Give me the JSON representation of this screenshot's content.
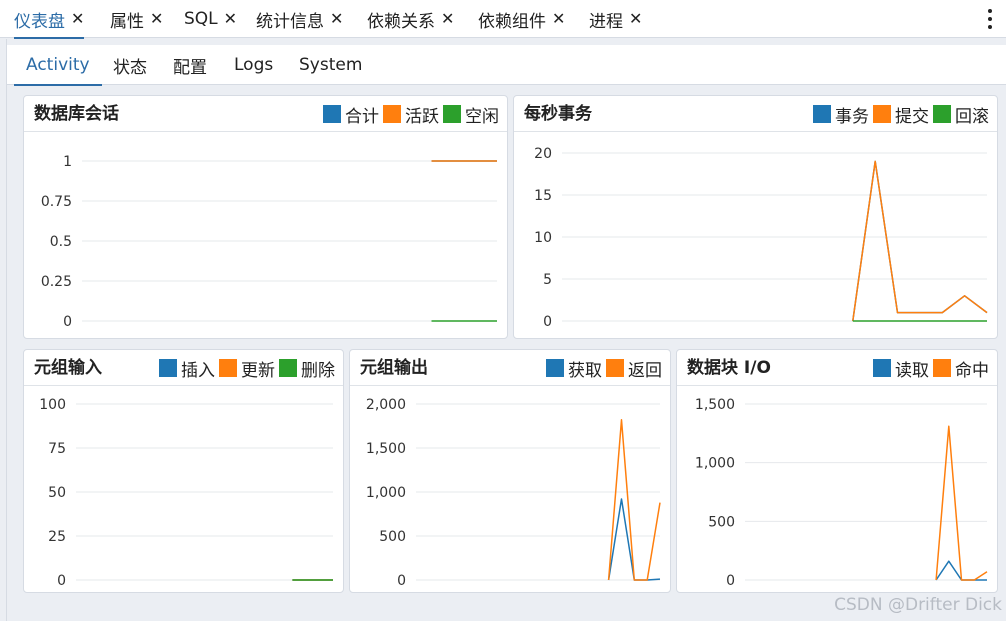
{
  "top_tabs": [
    {
      "label": "仪表盘",
      "active": true
    },
    {
      "label": "属性"
    },
    {
      "label": "SQL"
    },
    {
      "label": "统计信息"
    },
    {
      "label": "依赖关系"
    },
    {
      "label": "依赖组件"
    },
    {
      "label": "进程"
    }
  ],
  "sub_tabs": [
    {
      "label": "Activity",
      "active": true
    },
    {
      "label": "状态"
    },
    {
      "label": "配置"
    },
    {
      "label": "Logs"
    },
    {
      "label": "System"
    }
  ],
  "colors": {
    "blue": "#1f77b4",
    "orange": "#ff7f0e",
    "green": "#2ca02c",
    "accent": "#2c6ca7"
  },
  "watermark": "CSDN @Drifter Dick",
  "chart_data": [
    {
      "id": "sessions",
      "type": "line",
      "title": "数据库会话",
      "ylim": [
        0,
        1
      ],
      "yticks": [
        "0",
        "0.25",
        "0.5",
        "0.75",
        "1"
      ],
      "ytick_values": [
        0,
        0.25,
        0.5,
        0.75,
        1
      ],
      "x": [
        0,
        1,
        2,
        3,
        4,
        5,
        6,
        7,
        8,
        9,
        10,
        11,
        12,
        13,
        14,
        15,
        16,
        17,
        18,
        19
      ],
      "series": [
        {
          "name": "合计",
          "color": "#1f77b4",
          "values": [
            null,
            null,
            null,
            null,
            null,
            null,
            null,
            null,
            null,
            null,
            null,
            null,
            null,
            null,
            null,
            null,
            1,
            1,
            1,
            1
          ]
        },
        {
          "name": "活跃",
          "color": "#ff7f0e",
          "values": [
            null,
            null,
            null,
            null,
            null,
            null,
            null,
            null,
            null,
            null,
            null,
            null,
            null,
            null,
            null,
            null,
            1,
            1,
            1,
            1
          ]
        },
        {
          "name": "空闲",
          "color": "#2ca02c",
          "values": [
            null,
            null,
            null,
            null,
            null,
            null,
            null,
            null,
            null,
            null,
            null,
            null,
            null,
            null,
            null,
            null,
            0,
            0,
            0,
            0
          ]
        }
      ]
    },
    {
      "id": "tps",
      "type": "line",
      "title": "每秒事务",
      "ylim": [
        0,
        20
      ],
      "yticks": [
        "0",
        "5",
        "10",
        "15",
        "20"
      ],
      "ytick_values": [
        0,
        5,
        10,
        15,
        20
      ],
      "x": [
        0,
        1,
        2,
        3,
        4,
        5,
        6,
        7,
        8,
        9,
        10,
        11,
        12,
        13,
        14,
        15,
        16,
        17,
        18,
        19
      ],
      "series": [
        {
          "name": "事务",
          "color": "#1f77b4",
          "values": [
            null,
            null,
            null,
            null,
            null,
            null,
            null,
            null,
            null,
            null,
            null,
            null,
            null,
            0,
            19,
            1,
            1,
            1,
            3,
            1
          ]
        },
        {
          "name": "提交",
          "color": "#ff7f0e",
          "values": [
            null,
            null,
            null,
            null,
            null,
            null,
            null,
            null,
            null,
            null,
            null,
            null,
            null,
            0,
            19,
            1,
            1,
            1,
            3,
            1
          ]
        },
        {
          "name": "回滚",
          "color": "#2ca02c",
          "values": [
            null,
            null,
            null,
            null,
            null,
            null,
            null,
            null,
            null,
            null,
            null,
            null,
            null,
            0,
            0,
            0,
            0,
            0,
            0,
            0
          ]
        }
      ]
    },
    {
      "id": "tuples_in",
      "type": "line",
      "title": "元组输入",
      "ylim": [
        0,
        100
      ],
      "yticks": [
        "0",
        "25",
        "50",
        "75",
        "100"
      ],
      "ytick_values": [
        0,
        25,
        50,
        75,
        100
      ],
      "x": [
        0,
        1,
        2,
        3,
        4,
        5,
        6,
        7,
        8,
        9,
        10,
        11,
        12,
        13,
        14,
        15,
        16,
        17,
        18,
        19
      ],
      "series": [
        {
          "name": "插入",
          "color": "#1f77b4",
          "values": [
            null,
            null,
            null,
            null,
            null,
            null,
            null,
            null,
            null,
            null,
            null,
            null,
            null,
            null,
            null,
            null,
            0,
            0,
            0,
            0
          ]
        },
        {
          "name": "更新",
          "color": "#ff7f0e",
          "values": [
            null,
            null,
            null,
            null,
            null,
            null,
            null,
            null,
            null,
            null,
            null,
            null,
            null,
            null,
            null,
            null,
            0,
            0,
            0,
            0
          ]
        },
        {
          "name": "删除",
          "color": "#2ca02c",
          "values": [
            null,
            null,
            null,
            null,
            null,
            null,
            null,
            null,
            null,
            null,
            null,
            null,
            null,
            null,
            null,
            null,
            0,
            0,
            0,
            0
          ]
        }
      ]
    },
    {
      "id": "tuples_out",
      "type": "line",
      "title": "元组输出",
      "ylim": [
        0,
        2000
      ],
      "yticks": [
        "0",
        "500",
        "1,000",
        "1,500",
        "2,000"
      ],
      "ytick_values": [
        0,
        500,
        1000,
        1500,
        2000
      ],
      "x": [
        0,
        1,
        2,
        3,
        4,
        5,
        6,
        7,
        8,
        9,
        10,
        11,
        12,
        13,
        14,
        15,
        16,
        17,
        18,
        19
      ],
      "series": [
        {
          "name": "获取",
          "color": "#1f77b4",
          "values": [
            null,
            null,
            null,
            null,
            null,
            null,
            null,
            null,
            null,
            null,
            null,
            null,
            null,
            null,
            null,
            0,
            920,
            0,
            0,
            10
          ]
        },
        {
          "name": "返回",
          "color": "#ff7f0e",
          "values": [
            null,
            null,
            null,
            null,
            null,
            null,
            null,
            null,
            null,
            null,
            null,
            null,
            null,
            null,
            null,
            0,
            1820,
            0,
            0,
            880
          ]
        }
      ]
    },
    {
      "id": "block_io",
      "type": "line",
      "title": "数据块 I/O",
      "ylim": [
        0,
        1500
      ],
      "yticks": [
        "0",
        "500",
        "1,000",
        "1,500"
      ],
      "ytick_values": [
        0,
        500,
        1000,
        1500
      ],
      "x": [
        0,
        1,
        2,
        3,
        4,
        5,
        6,
        7,
        8,
        9,
        10,
        11,
        12,
        13,
        14,
        15,
        16,
        17,
        18,
        19
      ],
      "series": [
        {
          "name": "读取",
          "color": "#1f77b4",
          "values": [
            null,
            null,
            null,
            null,
            null,
            null,
            null,
            null,
            null,
            null,
            null,
            null,
            null,
            null,
            null,
            0,
            160,
            0,
            0,
            0
          ]
        },
        {
          "name": "命中",
          "color": "#ff7f0e",
          "values": [
            null,
            null,
            null,
            null,
            null,
            null,
            null,
            null,
            null,
            null,
            null,
            null,
            null,
            null,
            null,
            0,
            1310,
            0,
            0,
            70
          ]
        }
      ]
    }
  ]
}
